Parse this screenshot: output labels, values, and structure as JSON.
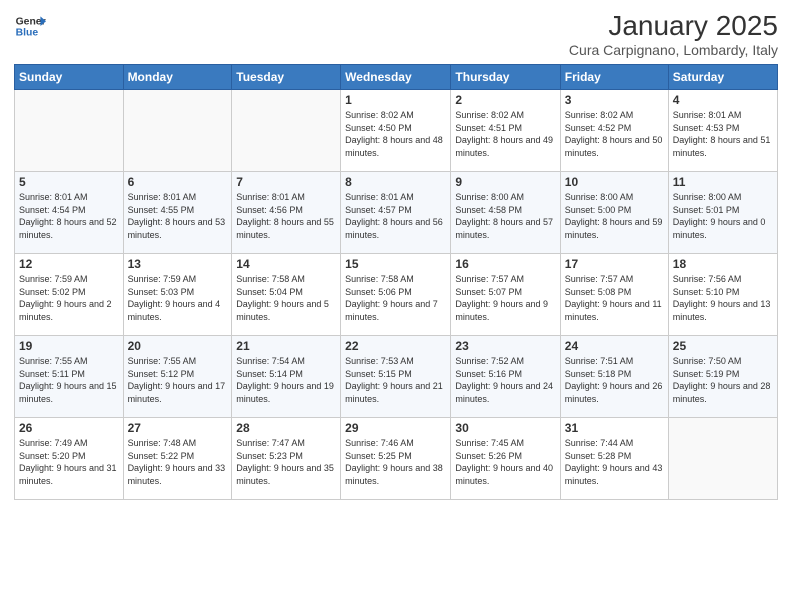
{
  "logo": {
    "line1": "General",
    "line2": "Blue"
  },
  "title": "January 2025",
  "subtitle": "Cura Carpignano, Lombardy, Italy",
  "weekdays": [
    "Sunday",
    "Monday",
    "Tuesday",
    "Wednesday",
    "Thursday",
    "Friday",
    "Saturday"
  ],
  "weeks": [
    [
      {
        "day": "",
        "info": ""
      },
      {
        "day": "",
        "info": ""
      },
      {
        "day": "",
        "info": ""
      },
      {
        "day": "1",
        "info": "Sunrise: 8:02 AM\nSunset: 4:50 PM\nDaylight: 8 hours and 48 minutes."
      },
      {
        "day": "2",
        "info": "Sunrise: 8:02 AM\nSunset: 4:51 PM\nDaylight: 8 hours and 49 minutes."
      },
      {
        "day": "3",
        "info": "Sunrise: 8:02 AM\nSunset: 4:52 PM\nDaylight: 8 hours and 50 minutes."
      },
      {
        "day": "4",
        "info": "Sunrise: 8:01 AM\nSunset: 4:53 PM\nDaylight: 8 hours and 51 minutes."
      }
    ],
    [
      {
        "day": "5",
        "info": "Sunrise: 8:01 AM\nSunset: 4:54 PM\nDaylight: 8 hours and 52 minutes."
      },
      {
        "day": "6",
        "info": "Sunrise: 8:01 AM\nSunset: 4:55 PM\nDaylight: 8 hours and 53 minutes."
      },
      {
        "day": "7",
        "info": "Sunrise: 8:01 AM\nSunset: 4:56 PM\nDaylight: 8 hours and 55 minutes."
      },
      {
        "day": "8",
        "info": "Sunrise: 8:01 AM\nSunset: 4:57 PM\nDaylight: 8 hours and 56 minutes."
      },
      {
        "day": "9",
        "info": "Sunrise: 8:00 AM\nSunset: 4:58 PM\nDaylight: 8 hours and 57 minutes."
      },
      {
        "day": "10",
        "info": "Sunrise: 8:00 AM\nSunset: 5:00 PM\nDaylight: 8 hours and 59 minutes."
      },
      {
        "day": "11",
        "info": "Sunrise: 8:00 AM\nSunset: 5:01 PM\nDaylight: 9 hours and 0 minutes."
      }
    ],
    [
      {
        "day": "12",
        "info": "Sunrise: 7:59 AM\nSunset: 5:02 PM\nDaylight: 9 hours and 2 minutes."
      },
      {
        "day": "13",
        "info": "Sunrise: 7:59 AM\nSunset: 5:03 PM\nDaylight: 9 hours and 4 minutes."
      },
      {
        "day": "14",
        "info": "Sunrise: 7:58 AM\nSunset: 5:04 PM\nDaylight: 9 hours and 5 minutes."
      },
      {
        "day": "15",
        "info": "Sunrise: 7:58 AM\nSunset: 5:06 PM\nDaylight: 9 hours and 7 minutes."
      },
      {
        "day": "16",
        "info": "Sunrise: 7:57 AM\nSunset: 5:07 PM\nDaylight: 9 hours and 9 minutes."
      },
      {
        "day": "17",
        "info": "Sunrise: 7:57 AM\nSunset: 5:08 PM\nDaylight: 9 hours and 11 minutes."
      },
      {
        "day": "18",
        "info": "Sunrise: 7:56 AM\nSunset: 5:10 PM\nDaylight: 9 hours and 13 minutes."
      }
    ],
    [
      {
        "day": "19",
        "info": "Sunrise: 7:55 AM\nSunset: 5:11 PM\nDaylight: 9 hours and 15 minutes."
      },
      {
        "day": "20",
        "info": "Sunrise: 7:55 AM\nSunset: 5:12 PM\nDaylight: 9 hours and 17 minutes."
      },
      {
        "day": "21",
        "info": "Sunrise: 7:54 AM\nSunset: 5:14 PM\nDaylight: 9 hours and 19 minutes."
      },
      {
        "day": "22",
        "info": "Sunrise: 7:53 AM\nSunset: 5:15 PM\nDaylight: 9 hours and 21 minutes."
      },
      {
        "day": "23",
        "info": "Sunrise: 7:52 AM\nSunset: 5:16 PM\nDaylight: 9 hours and 24 minutes."
      },
      {
        "day": "24",
        "info": "Sunrise: 7:51 AM\nSunset: 5:18 PM\nDaylight: 9 hours and 26 minutes."
      },
      {
        "day": "25",
        "info": "Sunrise: 7:50 AM\nSunset: 5:19 PM\nDaylight: 9 hours and 28 minutes."
      }
    ],
    [
      {
        "day": "26",
        "info": "Sunrise: 7:49 AM\nSunset: 5:20 PM\nDaylight: 9 hours and 31 minutes."
      },
      {
        "day": "27",
        "info": "Sunrise: 7:48 AM\nSunset: 5:22 PM\nDaylight: 9 hours and 33 minutes."
      },
      {
        "day": "28",
        "info": "Sunrise: 7:47 AM\nSunset: 5:23 PM\nDaylight: 9 hours and 35 minutes."
      },
      {
        "day": "29",
        "info": "Sunrise: 7:46 AM\nSunset: 5:25 PM\nDaylight: 9 hours and 38 minutes."
      },
      {
        "day": "30",
        "info": "Sunrise: 7:45 AM\nSunset: 5:26 PM\nDaylight: 9 hours and 40 minutes."
      },
      {
        "day": "31",
        "info": "Sunrise: 7:44 AM\nSunset: 5:28 PM\nDaylight: 9 hours and 43 minutes."
      },
      {
        "day": "",
        "info": ""
      }
    ]
  ]
}
